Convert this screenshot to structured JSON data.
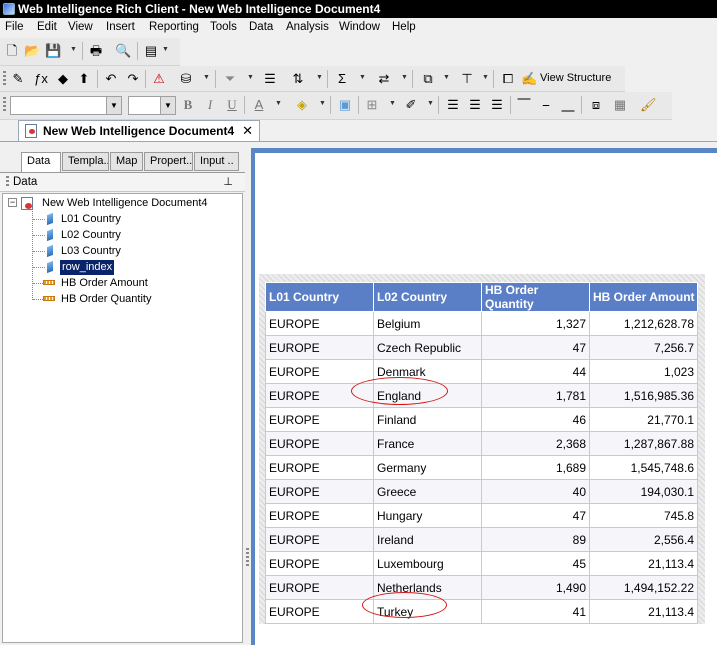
{
  "window": {
    "title": "Web Intelligence Rich Client - New Web Intelligence Document4"
  },
  "menu": [
    "File",
    "Edit",
    "View",
    "Insert",
    "Reporting",
    "Tools",
    "Data",
    "Analysis",
    "Window",
    "Help"
  ],
  "toolbar": {
    "view_structure": "View Structure"
  },
  "document_tab": {
    "label": "New Web Intelligence Document4",
    "close": "✕"
  },
  "left_panel": {
    "tabs": [
      "Data",
      "Templa..",
      "Map",
      "Propert..",
      "Input .."
    ],
    "header": "Data",
    "pin": "⊥",
    "tree": {
      "root": "New Web Intelligence Document4",
      "items": [
        {
          "label": "L01 Country",
          "kind": "dimension"
        },
        {
          "label": "L02 Country",
          "kind": "dimension"
        },
        {
          "label": "L03 Country",
          "kind": "dimension"
        },
        {
          "label": "row_index",
          "kind": "dimension",
          "selected": true
        },
        {
          "label": "HB Order Amount",
          "kind": "measure"
        },
        {
          "label": "HB Order Quantity",
          "kind": "measure"
        }
      ]
    }
  },
  "report_table": {
    "columns": [
      "L01 Country",
      "L02 Country",
      "HB Order Quantity",
      "HB Order Amount"
    ],
    "rows": [
      [
        "EUROPE",
        "Belgium",
        "1,327",
        "1,212,628.78"
      ],
      [
        "EUROPE",
        "Czech Republic",
        "47",
        "7,256.7"
      ],
      [
        "EUROPE",
        "Denmark",
        "44",
        "1,023"
      ],
      [
        "EUROPE",
        "England",
        "1,781",
        "1,516,985.36"
      ],
      [
        "EUROPE",
        "Finland",
        "46",
        "21,770.1"
      ],
      [
        "EUROPE",
        "France",
        "2,368",
        "1,287,867.88"
      ],
      [
        "EUROPE",
        "Germany",
        "1,689",
        "1,545,748.6"
      ],
      [
        "EUROPE",
        "Greece",
        "40",
        "194,030.1"
      ],
      [
        "EUROPE",
        "Hungary",
        "47",
        "745.8"
      ],
      [
        "EUROPE",
        "Ireland",
        "89",
        "2,556.4"
      ],
      [
        "EUROPE",
        "Luxembourg",
        "45",
        "21,113.4"
      ],
      [
        "EUROPE",
        "Netherlands",
        "1,490",
        "1,494,152.22"
      ],
      [
        "EUROPE",
        "Turkey",
        "41",
        "21,113.4"
      ]
    ]
  },
  "colors": {
    "header_bg": "#5b7fc6",
    "annotation": "#d01818",
    "selection": "#0a246a"
  }
}
